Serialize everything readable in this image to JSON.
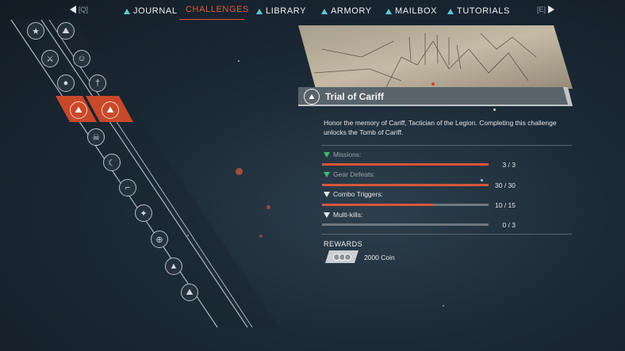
{
  "nav": {
    "prev_key": "[Q]",
    "next_key": "[E]",
    "tabs": [
      {
        "label": "JOURNAL"
      },
      {
        "label": "CHALLENGES"
      },
      {
        "label": "LIBRARY"
      },
      {
        "label": "ARMORY"
      },
      {
        "label": "MAILBOX"
      },
      {
        "label": "TUTORIALS"
      }
    ],
    "active_tab": "CHALLENGES",
    "accent_color": "#e0583a",
    "tab_icon_color": "#5ec8d8"
  },
  "challenge_list": {
    "icons": [
      "star-medal-icon",
      "tree-icon",
      "crossed-swords-icon",
      "person-icon",
      "bomb-icon",
      "sword-icon",
      "tree-icon",
      "tree-icon",
      "skull-icon",
      "moon-icon",
      "gun-icon",
      "star-icon",
      "crosshair-icon",
      "mountain-icon",
      "mountains-icon"
    ],
    "selected_icon": "tree-icon"
  },
  "challenge": {
    "title": "Trial of Cariff",
    "description": "Honor the memory of Cariff, Tactician of the Legion. Completing this challenge unlocks the Tomb of Cariff.",
    "progress": [
      {
        "label": "Missions:",
        "current": 3,
        "total": 3,
        "display": "3 / 3",
        "complete": true
      },
      {
        "label": "Gear Defeats:",
        "current": 30,
        "total": 30,
        "display": "30 / 30",
        "complete": true
      },
      {
        "label": "Combo Triggers:",
        "current": 10,
        "total": 15,
        "display": "10 / 15",
        "complete": false
      },
      {
        "label": "Multi-kills:",
        "current": 0,
        "total": 3,
        "display": "0 / 3",
        "complete": false
      }
    ],
    "rewards_heading": "REWARDS",
    "rewards": [
      {
        "icon": "coins-icon",
        "label": "2000 Coin"
      }
    ]
  }
}
